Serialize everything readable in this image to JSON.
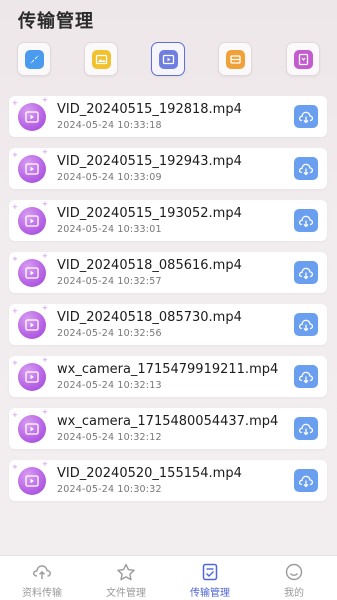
{
  "header": {
    "title": "传输管理"
  },
  "filters": [
    {
      "icon": "compass-icon",
      "color": "#4a9bee",
      "active": false
    },
    {
      "icon": "image-icon",
      "color": "#f2c12e",
      "active": false
    },
    {
      "icon": "video-icon",
      "color": "#6f7fe0",
      "active": true
    },
    {
      "icon": "audio-icon",
      "color": "#f0a23a",
      "active": false
    },
    {
      "icon": "document-icon",
      "color": "#c45bd0",
      "active": false
    }
  ],
  "files": [
    {
      "name": "VID_20240515_192818.mp4",
      "date": "2024-05-24 10:33:18"
    },
    {
      "name": "VID_20240515_192943.mp4",
      "date": "2024-05-24 10:33:09"
    },
    {
      "name": "VID_20240515_193052.mp4",
      "date": "2024-05-24 10:33:01"
    },
    {
      "name": "VID_20240518_085616.mp4",
      "date": "2024-05-24 10:32:57"
    },
    {
      "name": "VID_20240518_085730.mp4",
      "date": "2024-05-24 10:32:56"
    },
    {
      "name": "wx_camera_1715479919211.mp4",
      "date": "2024-05-24 10:32:13"
    },
    {
      "name": "wx_camera_1715480054437.mp4",
      "date": "2024-05-24 10:32:12"
    },
    {
      "name": "VID_20240520_155154.mp4",
      "date": "2024-05-24 10:30:32"
    }
  ],
  "tabbar": [
    {
      "label": "资料传输",
      "icon": "upload-cloud-icon",
      "active": false
    },
    {
      "label": "文件管理",
      "icon": "star-icon",
      "active": false
    },
    {
      "label": "传输管理",
      "icon": "transfer-doc-icon",
      "active": true
    },
    {
      "label": "我的",
      "icon": "smile-icon",
      "active": false
    }
  ],
  "colors": {
    "accent": "#4f66d8",
    "download": "#6a9ff0",
    "thumb": "#b866e6"
  }
}
